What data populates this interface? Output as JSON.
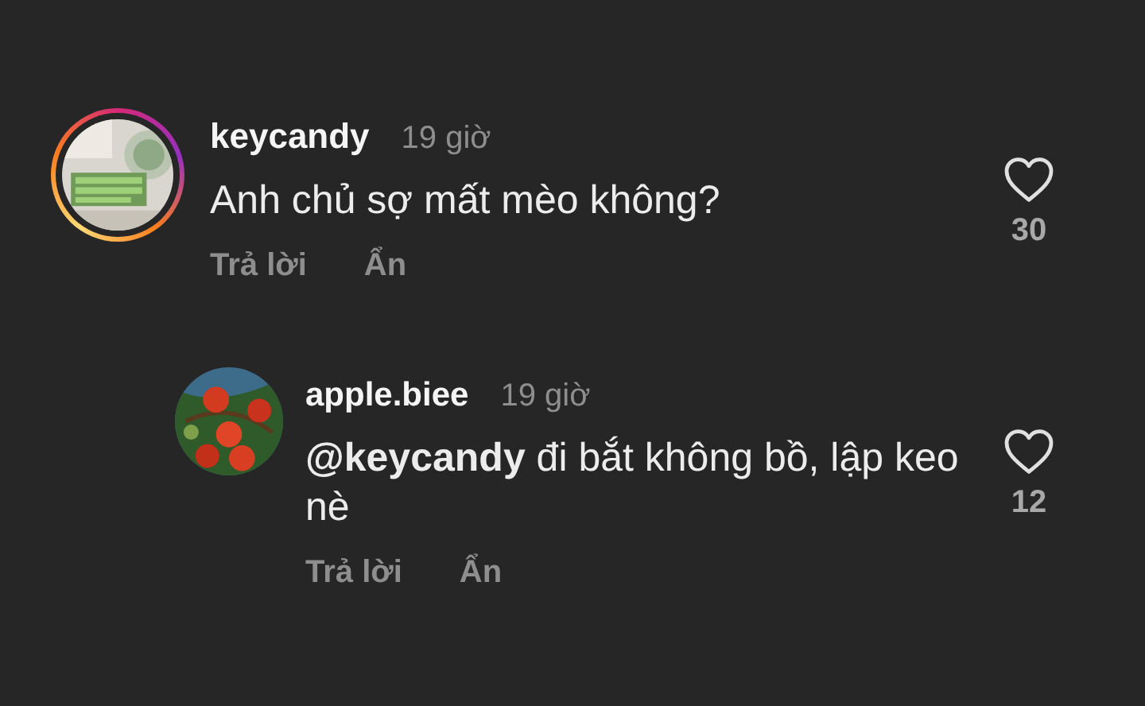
{
  "comments": [
    {
      "kind": "comment",
      "username": "keycandy",
      "time": "19 giờ",
      "text": "Anh chủ sợ mất mèo không?",
      "story_ring": true,
      "likes": "30",
      "liked": false,
      "actions": [
        "Trả lời",
        "Ẩn"
      ]
    },
    {
      "kind": "reply",
      "username": "apple.biee",
      "time": "19 giờ",
      "text": "**@keycandy**  đi bắt không bồ, lập keo nè",
      "story_ring": false,
      "likes": "12",
      "liked": false,
      "actions": [
        "Trả lời",
        "Ẩn"
      ]
    }
  ]
}
